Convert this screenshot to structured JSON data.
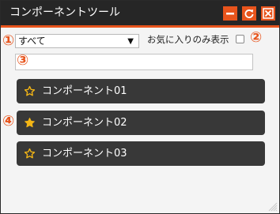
{
  "window": {
    "title": "コンポーネントツール",
    "buttons": [
      {
        "icon": "minimize-icon"
      },
      {
        "icon": "refresh-icon"
      },
      {
        "icon": "close-icon"
      }
    ]
  },
  "markers": [
    "①",
    "②",
    "③",
    "④"
  ],
  "filter": {
    "selected": "すべて",
    "arrow": "▼",
    "favorites_only_label": "お気に入りのみ表示",
    "favorites_only_checked": false
  },
  "search": {
    "value": "",
    "placeholder": ""
  },
  "components": [
    {
      "label": "コンポーネント01",
      "favorite": false
    },
    {
      "label": "コンポーネント02",
      "favorite": true
    },
    {
      "label": "コンポーネント03",
      "favorite": false
    }
  ],
  "colors": {
    "accent": "#e8541c",
    "titlebar": "#262626",
    "item_bg": "#383838",
    "star": "#f2b516"
  }
}
